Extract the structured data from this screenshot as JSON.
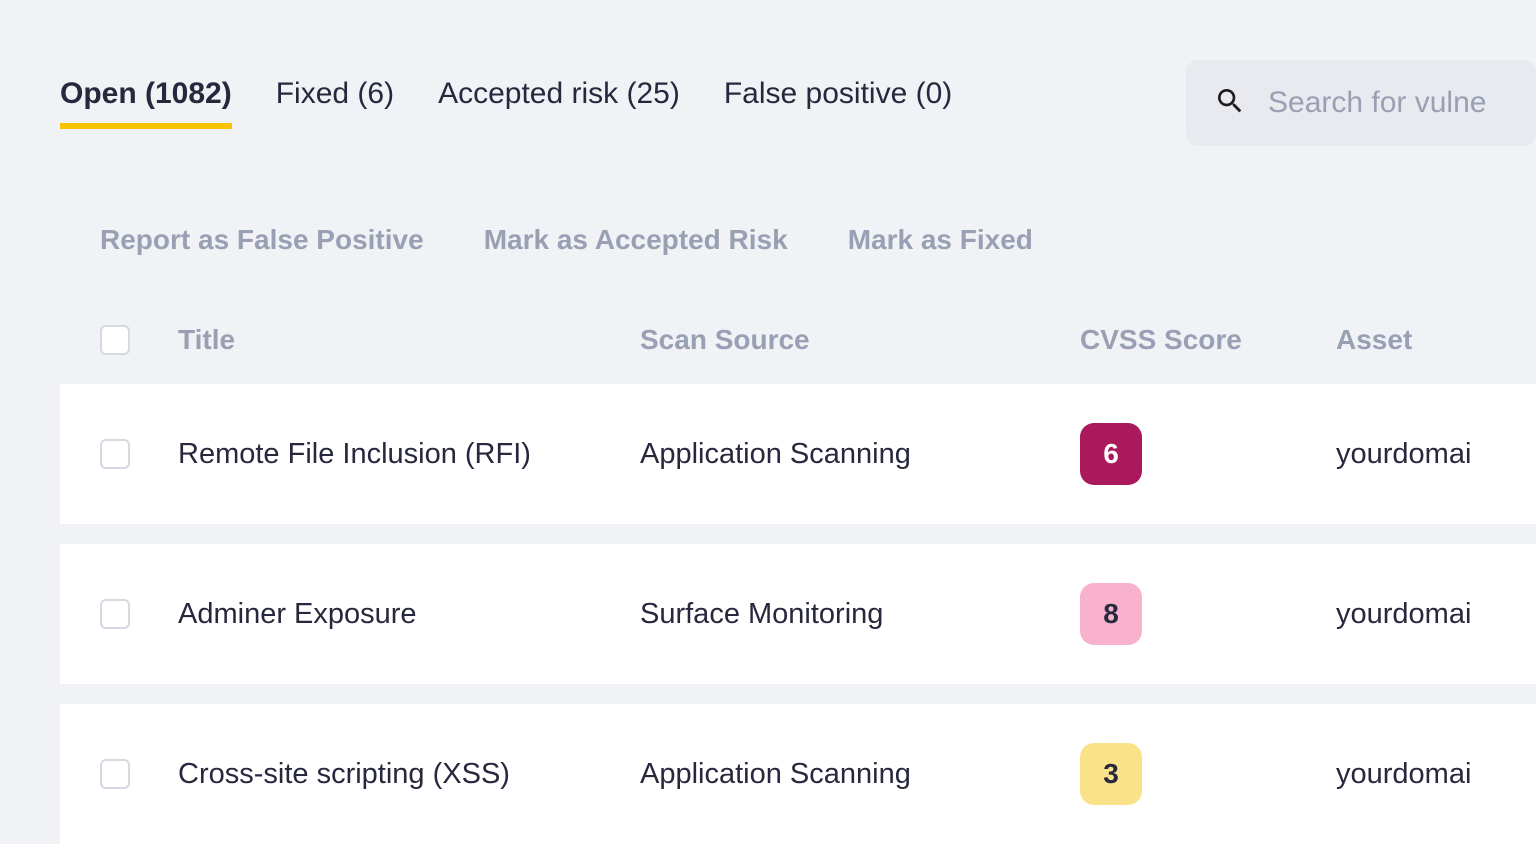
{
  "tabs": [
    {
      "id": "open",
      "label": "Open (1082)",
      "active": true
    },
    {
      "id": "fixed",
      "label": "Fixed (6)",
      "active": false
    },
    {
      "id": "accepted",
      "label": "Accepted risk (25)",
      "active": false
    },
    {
      "id": "falsepositive",
      "label": "False positive (0)",
      "active": false
    }
  ],
  "search": {
    "placeholder": "Search for vulne"
  },
  "bulk_actions": {
    "report_false_positive": "Report as False Positive",
    "mark_accepted_risk": "Mark as Accepted Risk",
    "mark_fixed": "Mark as Fixed"
  },
  "columns": {
    "title": "Title",
    "scan_source": "Scan Source",
    "cvss": "CVSS Score",
    "asset": "Asset"
  },
  "rows": [
    {
      "title": "Remote File Inclusion (RFI)",
      "scan_source": "Application Scanning",
      "cvss": "6",
      "cvss_class": "score-maroon",
      "asset": "yourdomai"
    },
    {
      "title": "Adminer Exposure",
      "scan_source": "Surface Monitoring",
      "cvss": "8",
      "cvss_class": "score-pink",
      "asset": "yourdomai"
    },
    {
      "title": "Cross-site scripting (XSS)",
      "scan_source": "Application Scanning",
      "cvss": "3",
      "cvss_class": "score-yellow",
      "asset": "yourdomai"
    }
  ],
  "icons": {
    "search": "search-icon"
  }
}
